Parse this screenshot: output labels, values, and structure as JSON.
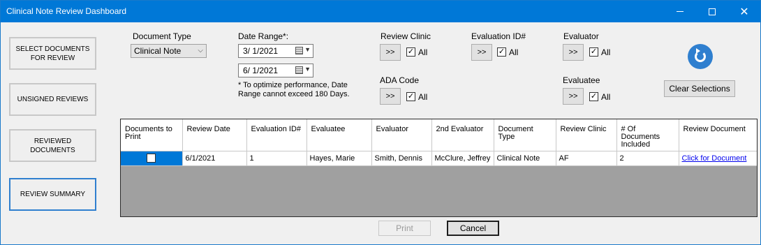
{
  "window": {
    "title": "Clinical Note Review Dashboard",
    "minimize_glyph": "",
    "close_glyph": "✕"
  },
  "nav": {
    "select_documents": "SELECT DOCUMENTS FOR REVIEW",
    "unsigned_reviews": "UNSIGNED REVIEWS",
    "reviewed_documents": "REVIEWED DOCUMENTS",
    "review_summary": "REVIEW SUMMARY"
  },
  "filters": {
    "document_type_label": "Document Type",
    "document_type_value": "Clinical Note",
    "date_range_label": "Date Range*:",
    "date_from": "3/  1/2021",
    "date_to": "6/  1/2021",
    "date_note": "* To optimize performance, Date Range cannot exceed 180 Days.",
    "review_clinic_label": "Review Clinic",
    "evaluation_id_label": "Evaluation ID#",
    "evaluator_label": "Evaluator",
    "ada_code_label": "ADA Code",
    "evaluatee_label": "Evaluatee",
    "pick_button": ">>",
    "all_label": "All",
    "check_mark": "✓"
  },
  "actions": {
    "clear_selections": "Clear Selections",
    "print": "Print",
    "cancel": "Cancel"
  },
  "grid": {
    "columns": [
      "Documents to Print",
      "Review Date",
      "Evaluation ID#",
      "Evaluatee",
      "Evaluator",
      "2nd Evaluator",
      "Document Type",
      "Review Clinic",
      "# Of Documents Included",
      "Review Document"
    ],
    "rows": [
      {
        "review_date": "6/1/2021",
        "evaluation_id": "1",
        "evaluatee": "Hayes, Marie",
        "evaluator": "Smith, Dennis",
        "second_evaluator": "McClure, Jeffrey",
        "document_type": "Clinical Note",
        "review_clinic": "AF",
        "documents_included": "2",
        "review_document": "Click for Document"
      }
    ]
  },
  "colors": {
    "titlebar": "#0078d7",
    "accent": "#2f7fcf",
    "grid_background": "#a0a0a0",
    "selection": "#0078d7"
  }
}
